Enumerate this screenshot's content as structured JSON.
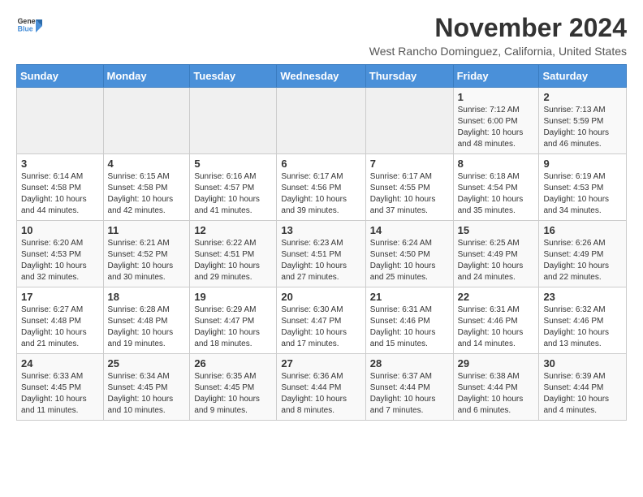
{
  "logo": {
    "general": "General",
    "blue": "Blue"
  },
  "title": "November 2024",
  "subtitle": "West Rancho Dominguez, California, United States",
  "headers": [
    "Sunday",
    "Monday",
    "Tuesday",
    "Wednesday",
    "Thursday",
    "Friday",
    "Saturday"
  ],
  "weeks": [
    [
      {
        "day": "",
        "info": ""
      },
      {
        "day": "",
        "info": ""
      },
      {
        "day": "",
        "info": ""
      },
      {
        "day": "",
        "info": ""
      },
      {
        "day": "",
        "info": ""
      },
      {
        "day": "1",
        "info": "Sunrise: 7:12 AM\nSunset: 6:00 PM\nDaylight: 10 hours\nand 48 minutes."
      },
      {
        "day": "2",
        "info": "Sunrise: 7:13 AM\nSunset: 5:59 PM\nDaylight: 10 hours\nand 46 minutes."
      }
    ],
    [
      {
        "day": "3",
        "info": "Sunrise: 6:14 AM\nSunset: 4:58 PM\nDaylight: 10 hours\nand 44 minutes."
      },
      {
        "day": "4",
        "info": "Sunrise: 6:15 AM\nSunset: 4:58 PM\nDaylight: 10 hours\nand 42 minutes."
      },
      {
        "day": "5",
        "info": "Sunrise: 6:16 AM\nSunset: 4:57 PM\nDaylight: 10 hours\nand 41 minutes."
      },
      {
        "day": "6",
        "info": "Sunrise: 6:17 AM\nSunset: 4:56 PM\nDaylight: 10 hours\nand 39 minutes."
      },
      {
        "day": "7",
        "info": "Sunrise: 6:17 AM\nSunset: 4:55 PM\nDaylight: 10 hours\nand 37 minutes."
      },
      {
        "day": "8",
        "info": "Sunrise: 6:18 AM\nSunset: 4:54 PM\nDaylight: 10 hours\nand 35 minutes."
      },
      {
        "day": "9",
        "info": "Sunrise: 6:19 AM\nSunset: 4:53 PM\nDaylight: 10 hours\nand 34 minutes."
      }
    ],
    [
      {
        "day": "10",
        "info": "Sunrise: 6:20 AM\nSunset: 4:53 PM\nDaylight: 10 hours\nand 32 minutes."
      },
      {
        "day": "11",
        "info": "Sunrise: 6:21 AM\nSunset: 4:52 PM\nDaylight: 10 hours\nand 30 minutes."
      },
      {
        "day": "12",
        "info": "Sunrise: 6:22 AM\nSunset: 4:51 PM\nDaylight: 10 hours\nand 29 minutes."
      },
      {
        "day": "13",
        "info": "Sunrise: 6:23 AM\nSunset: 4:51 PM\nDaylight: 10 hours\nand 27 minutes."
      },
      {
        "day": "14",
        "info": "Sunrise: 6:24 AM\nSunset: 4:50 PM\nDaylight: 10 hours\nand 25 minutes."
      },
      {
        "day": "15",
        "info": "Sunrise: 6:25 AM\nSunset: 4:49 PM\nDaylight: 10 hours\nand 24 minutes."
      },
      {
        "day": "16",
        "info": "Sunrise: 6:26 AM\nSunset: 4:49 PM\nDaylight: 10 hours\nand 22 minutes."
      }
    ],
    [
      {
        "day": "17",
        "info": "Sunrise: 6:27 AM\nSunset: 4:48 PM\nDaylight: 10 hours\nand 21 minutes."
      },
      {
        "day": "18",
        "info": "Sunrise: 6:28 AM\nSunset: 4:48 PM\nDaylight: 10 hours\nand 19 minutes."
      },
      {
        "day": "19",
        "info": "Sunrise: 6:29 AM\nSunset: 4:47 PM\nDaylight: 10 hours\nand 18 minutes."
      },
      {
        "day": "20",
        "info": "Sunrise: 6:30 AM\nSunset: 4:47 PM\nDaylight: 10 hours\nand 17 minutes."
      },
      {
        "day": "21",
        "info": "Sunrise: 6:31 AM\nSunset: 4:46 PM\nDaylight: 10 hours\nand 15 minutes."
      },
      {
        "day": "22",
        "info": "Sunrise: 6:31 AM\nSunset: 4:46 PM\nDaylight: 10 hours\nand 14 minutes."
      },
      {
        "day": "23",
        "info": "Sunrise: 6:32 AM\nSunset: 4:46 PM\nDaylight: 10 hours\nand 13 minutes."
      }
    ],
    [
      {
        "day": "24",
        "info": "Sunrise: 6:33 AM\nSunset: 4:45 PM\nDaylight: 10 hours\nand 11 minutes."
      },
      {
        "day": "25",
        "info": "Sunrise: 6:34 AM\nSunset: 4:45 PM\nDaylight: 10 hours\nand 10 minutes."
      },
      {
        "day": "26",
        "info": "Sunrise: 6:35 AM\nSunset: 4:45 PM\nDaylight: 10 hours\nand 9 minutes."
      },
      {
        "day": "27",
        "info": "Sunrise: 6:36 AM\nSunset: 4:44 PM\nDaylight: 10 hours\nand 8 minutes."
      },
      {
        "day": "28",
        "info": "Sunrise: 6:37 AM\nSunset: 4:44 PM\nDaylight: 10 hours\nand 7 minutes."
      },
      {
        "day": "29",
        "info": "Sunrise: 6:38 AM\nSunset: 4:44 PM\nDaylight: 10 hours\nand 6 minutes."
      },
      {
        "day": "30",
        "info": "Sunrise: 6:39 AM\nSunset: 4:44 PM\nDaylight: 10 hours\nand 4 minutes."
      }
    ]
  ]
}
